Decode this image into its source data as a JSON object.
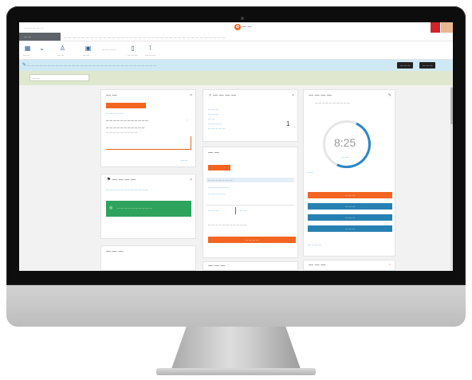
{
  "window": {
    "brand_link": "— — — — —",
    "logo_text": "— —"
  },
  "menubar": {
    "active": "— —",
    "items": [
      "— — — — — — — — — — — — — — — — — — — — — — — — — — — — — — — — — — — — —"
    ]
  },
  "toolbar": {
    "labels": [
      "— —",
      "— —",
      "— — — —",
      "— — —"
    ]
  },
  "notice": {
    "text": "— — — — — — — — — — — — — — — — — — — — — — — — — — — — — — — —",
    "btn_left": "— — —",
    "btn_right": "— — —"
  },
  "search": {
    "value": "— —"
  },
  "cards": {
    "c1": {
      "title": "— —",
      "line1": "— — — — —",
      "line2": "— — — — — — — — — — — —",
      "line3": "— — — — — — — — — — —",
      "line4": "— — — — — — — — —",
      "foot": "— —"
    },
    "c2": {
      "title": "— — — —",
      "line1": "— — — — — — — — — — — —",
      "btn": "— — — — — — — — — —"
    },
    "c3": {
      "title": "— — —"
    },
    "c4": {
      "title": "— — — —",
      "l1": "— — —",
      "l2": "— — —",
      "l3": "— —",
      "l4": "— — — —",
      "l5": "— — — — —",
      "value": "1"
    },
    "c5": {
      "title": "— —",
      "row1": "— — — — — — —",
      "row2": "— — — — — —",
      "row3": "— — — — —",
      "btn1": "— — —",
      "btn2": "— —",
      "foot1": "— — — — — — — — — — —",
      "btn3": "— — — —"
    },
    "c6": {
      "title": "— — —"
    },
    "c7": {
      "title": "— — — —",
      "subtitle": "— — — — — — — — — —",
      "dial": "8:25",
      "dial_sub": "— —",
      "side": "— —",
      "b1": "— — —",
      "b2": "— — —",
      "b3": "— — —",
      "b4": "— — —",
      "foot": "— — — —"
    },
    "c8": {
      "title": "— — —"
    }
  },
  "colors": {
    "accent_orange": "#f26522",
    "accent_blue": "#2780b2",
    "success_green": "#2ea35c",
    "notice_bg": "#cfe9f4",
    "search_band_bg": "#dfe8cf"
  }
}
